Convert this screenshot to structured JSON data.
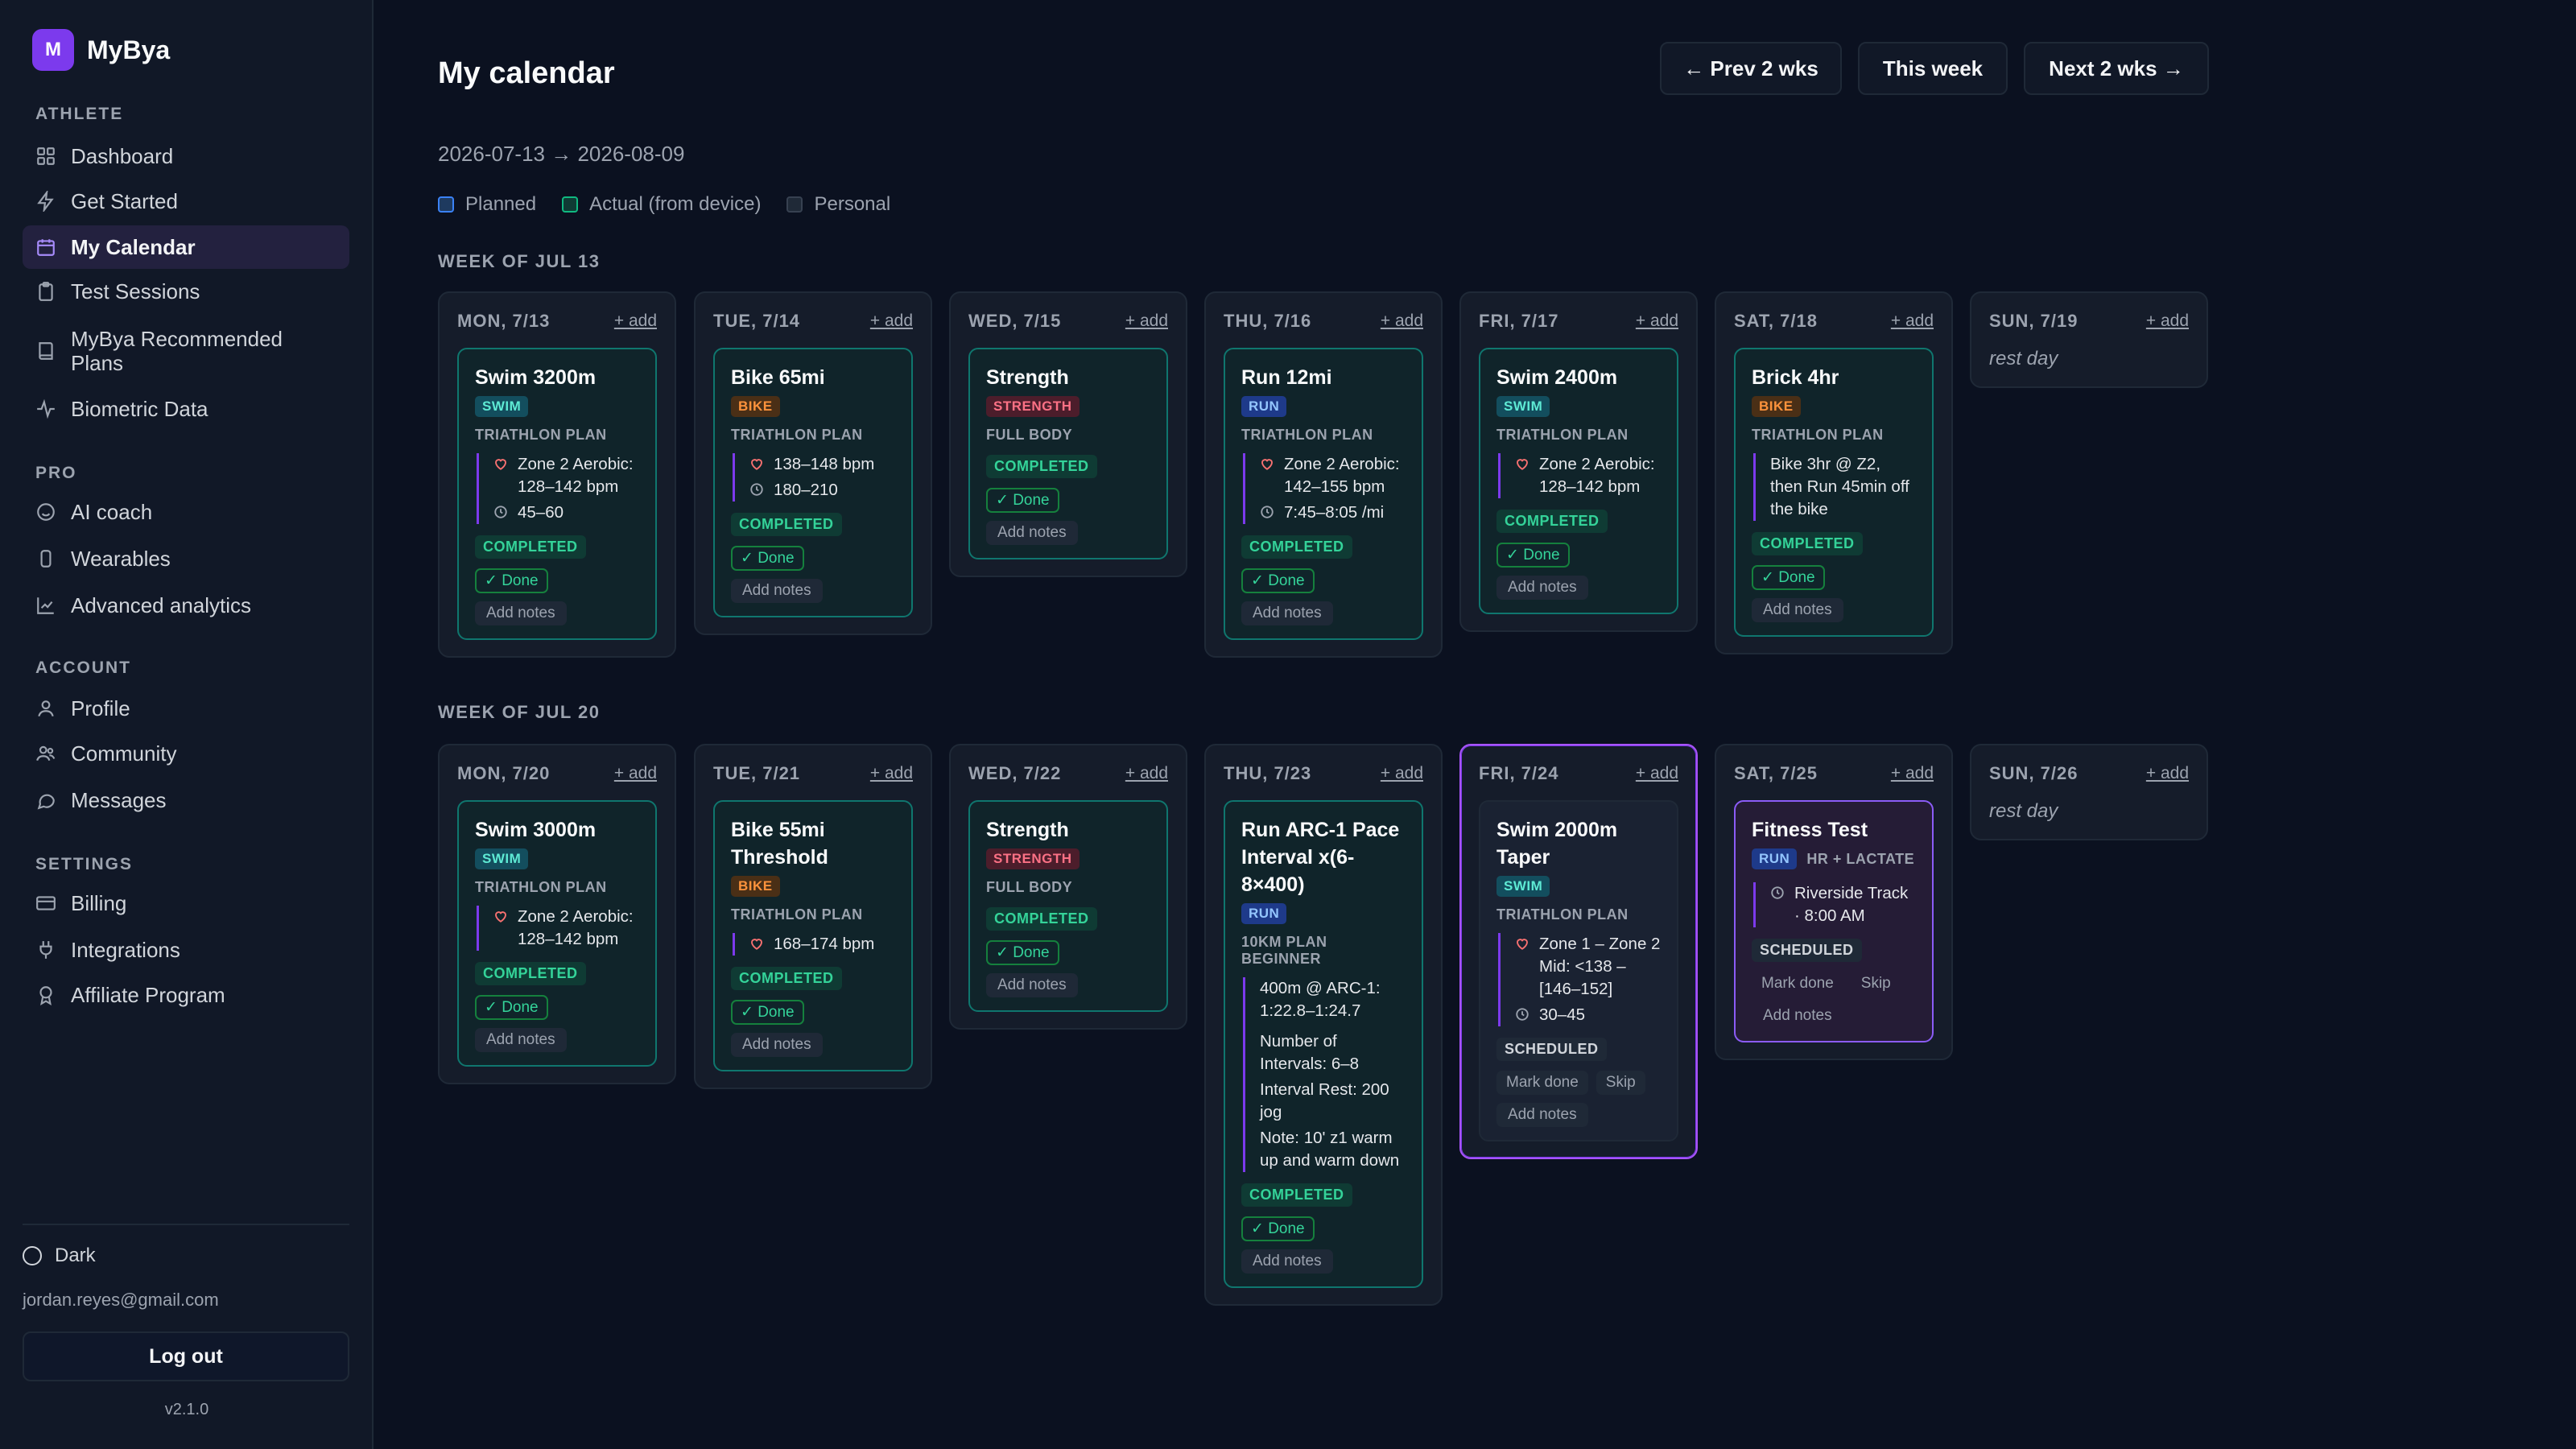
{
  "app": {
    "logo_letter": "M",
    "name": "MyBya"
  },
  "sidebar": {
    "sections": {
      "athlete": "ATHLETE",
      "pro": "PRO",
      "account": "ACCOUNT",
      "settings": "SETTINGS"
    },
    "items": [
      {
        "label": "Dashboard",
        "icon": "dashboard-icon"
      },
      {
        "label": "Get Started",
        "icon": "bolt-icon"
      },
      {
        "label": "My Calendar",
        "icon": "calendar-icon",
        "active": true
      },
      {
        "label": "Test Sessions",
        "icon": "clipboard-icon"
      },
      {
        "label": "MyBya Recommended Plans",
        "icon": "book-icon"
      },
      {
        "label": "Biometric Data",
        "icon": "pulse-icon"
      },
      {
        "label": "AI coach",
        "icon": "chat-bot-icon"
      },
      {
        "label": "Wearables",
        "icon": "watch-icon"
      },
      {
        "label": "Advanced analytics",
        "icon": "chart-icon"
      },
      {
        "label": "Profile",
        "icon": "user-icon"
      },
      {
        "label": "Community",
        "icon": "users-icon"
      },
      {
        "label": "Messages",
        "icon": "message-icon"
      },
      {
        "label": "Billing",
        "icon": "credit-card-icon"
      },
      {
        "label": "Integrations",
        "icon": "plug-icon"
      },
      {
        "label": "Affiliate Program",
        "icon": "award-icon"
      }
    ],
    "theme_label": "Dark",
    "user_email": "jordan.reyes@gmail.com",
    "logout_label": "Log out",
    "version": "v2.1.0"
  },
  "header": {
    "title": "My calendar",
    "prev_label": "← Prev 2 wks",
    "this_week_label": "This week",
    "next_label": "Next 2 wks →",
    "date_range": "2026-07-13 → 2026-08-09"
  },
  "legend": [
    {
      "label": "Planned",
      "color": "#1e3a5f",
      "border": "#3b82f6"
    },
    {
      "label": "Actual (from device)",
      "color": "#0f3b34",
      "border": "#10b981"
    },
    {
      "label": "Personal",
      "color": "#1f2937",
      "border": "#374151"
    }
  ],
  "common": {
    "add_label": "+ add",
    "rest_label": "rest day",
    "done_label": "✓ Done",
    "notes_label": "Add notes",
    "mark_done_label": "Mark done",
    "skip_label": "Skip"
  },
  "colors": {
    "accent": "#7c3aed",
    "completed": "#34d399",
    "today_border": "#a855f7"
  },
  "weeks": [
    {
      "label": "WEEK OF JUL 13",
      "days": [
        {
          "name": "MON, 7/13",
          "card": {
            "title": "Swim 3200m",
            "tag": "SWIM",
            "plan": "TRIATHLON PLAN",
            "details": [
              "Zone 2 Aerobic: 128–142 bpm",
              "45–60"
            ],
            "status": "COMPLETED"
          }
        },
        {
          "name": "TUE, 7/14",
          "card": {
            "title": "Bike 65mi",
            "tag": "BIKE",
            "plan": "TRIATHLON PLAN",
            "details": [
              "138–148 bpm",
              "180–210"
            ],
            "status": "COMPLETED"
          }
        },
        {
          "name": "WED, 7/15",
          "card": {
            "title": "Strength",
            "tag": "STRENGTH",
            "plan": "FULL BODY",
            "status": "COMPLETED"
          }
        },
        {
          "name": "THU, 7/16",
          "card": {
            "title": "Run 12mi",
            "tag": "RUN",
            "plan": "TRIATHLON PLAN",
            "details": [
              "Zone 2 Aerobic: 142–155 bpm",
              "7:45–8:05 /mi"
            ],
            "status": "COMPLETED"
          }
        },
        {
          "name": "FRI, 7/17",
          "card": {
            "title": "Swim 2400m",
            "tag": "SWIM",
            "plan": "TRIATHLON PLAN",
            "details": [
              "Zone 2 Aerobic: 128–142 bpm"
            ],
            "status": "COMPLETED"
          }
        },
        {
          "name": "SAT, 7/18",
          "card": {
            "title": "Brick 4hr",
            "tag": "BIKE",
            "plan": "TRIATHLON PLAN",
            "details": [
              "Bike 3hr @ Z2, then Run 45min off the bike"
            ],
            "status": "COMPLETED"
          }
        },
        {
          "name": "SUN, 7/19"
        }
      ]
    },
    {
      "label": "WEEK OF JUL 20",
      "days": [
        {
          "name": "MON, 7/20",
          "card": {
            "title": "Swim 3000m",
            "tag": "SWIM",
            "plan": "TRIATHLON PLAN",
            "details": [
              "Zone 2 Aerobic: 128–142 bpm"
            ],
            "status": "COMPLETED"
          }
        },
        {
          "name": "TUE, 7/21",
          "card": {
            "title": "Bike 55mi Threshold",
            "tag": "BIKE",
            "plan": "TRIATHLON PLAN",
            "details": [
              "168–174 bpm"
            ],
            "status": "COMPLETED"
          }
        },
        {
          "name": "WED, 7/22",
          "card": {
            "title": "Strength",
            "tag": "STRENGTH",
            "plan": "FULL BODY",
            "status": "COMPLETED"
          }
        },
        {
          "name": "THU, 7/23",
          "card": {
            "title": "Run ARC-1 Pace Interval x(6-8×400)",
            "tag": "RUN",
            "plan": "10KM PLAN BEGINNER",
            "details": [
              "400m @ ARC-1: 1:22.8–1:24.7",
              "Number of Intervals: 6–8",
              "Interval Rest: 200 jog",
              "Note: 10' z1 warm up and warm down"
            ],
            "status": "COMPLETED"
          }
        },
        {
          "name": "FRI, 7/24",
          "card": {
            "title": "Swim 2000m Taper",
            "tag": "SWIM",
            "plan": "TRIATHLON PLAN",
            "details": [
              "Zone 1 – Zone 2 Mid: <138 – [146–152]",
              "30–45"
            ],
            "status": "SCHEDULED"
          }
        },
        {
          "name": "SAT, 7/25",
          "card": {
            "title": "Fitness Test",
            "tag": "RUN",
            "tag_extra": "HR + LACTATE",
            "details": [
              "Riverside Track · 8:00 AM"
            ],
            "status": "SCHEDULED"
          }
        },
        {
          "name": "SUN, 7/26"
        }
      ]
    }
  ]
}
